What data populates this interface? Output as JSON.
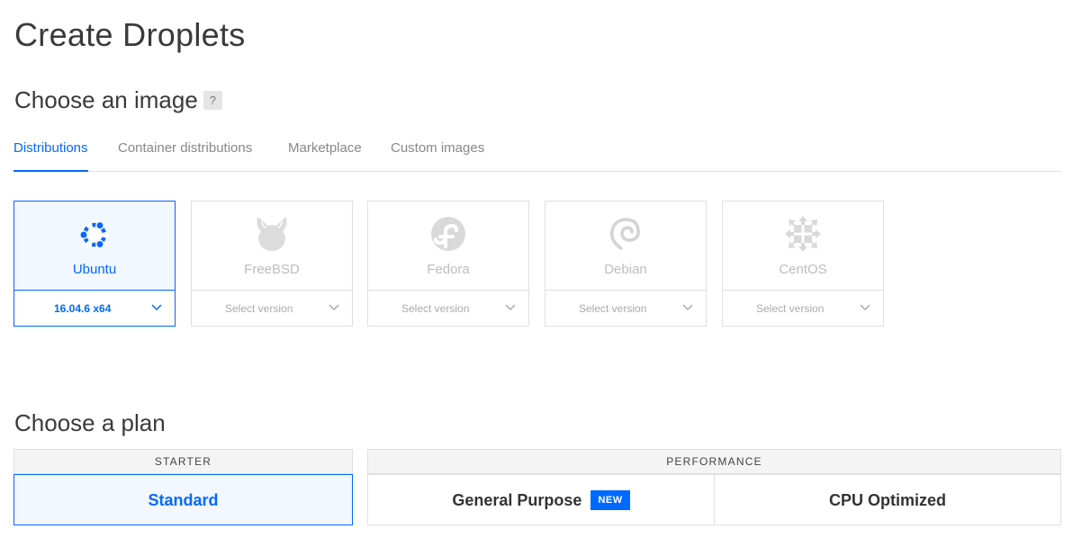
{
  "page": {
    "title": "Create Droplets"
  },
  "image_section": {
    "title": "Choose an image",
    "help_glyph": "?",
    "tabs": [
      {
        "label": "Distributions",
        "active": true
      },
      {
        "label": "Container distributions",
        "active": false
      },
      {
        "label": "Marketplace",
        "active": false
      },
      {
        "label": "Custom images",
        "active": false
      }
    ],
    "distributions": [
      {
        "name": "Ubuntu",
        "icon": "ubuntu-logo-icon",
        "version": "16.04.6 x64",
        "selected": true
      },
      {
        "name": "FreeBSD",
        "icon": "freebsd-logo-icon",
        "version": "Select version",
        "selected": false
      },
      {
        "name": "Fedora",
        "icon": "fedora-logo-icon",
        "version": "Select version",
        "selected": false
      },
      {
        "name": "Debian",
        "icon": "debian-logo-icon",
        "version": "Select version",
        "selected": false
      },
      {
        "name": "CentOS",
        "icon": "centos-logo-icon",
        "version": "Select version",
        "selected": false
      }
    ]
  },
  "plan_section": {
    "title": "Choose a plan",
    "groups": [
      {
        "label": "STARTER",
        "options": [
          {
            "label": "Standard",
            "selected": true
          }
        ]
      },
      {
        "label": "PERFORMANCE",
        "options": [
          {
            "label": "General Purpose",
            "badge": "NEW",
            "selected": false
          },
          {
            "label": "CPU Optimized",
            "selected": false
          }
        ]
      }
    ]
  },
  "colors": {
    "accent": "#0069ff",
    "border": "#e0e0e0",
    "muted_text": "#888888",
    "selected_bg": "#f3f7ff"
  }
}
